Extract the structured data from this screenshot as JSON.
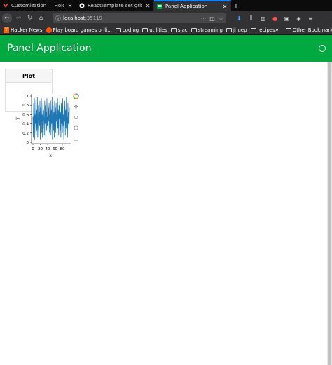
{
  "tabs": [
    {
      "label": "Customization — HoloViews",
      "icon": "holoviews-icon",
      "active": false
    },
    {
      "label": "ReactTemplate set grid item",
      "icon": "github-icon",
      "active": false
    },
    {
      "label": "Panel Application",
      "icon": "panel-icon",
      "active": true
    }
  ],
  "toolbar": {
    "url_host": "localhost",
    "url_port": ":35119",
    "overflow": "···"
  },
  "bookmarks": {
    "items": [
      {
        "label": "Hacker News",
        "icon": "hacker-news-icon"
      },
      {
        "label": "Play board games onli...",
        "icon": "boardgame-icon"
      },
      {
        "label": "coding",
        "icon": "folder-icon"
      },
      {
        "label": "utilities",
        "icon": "folder-icon"
      },
      {
        "label": "slac",
        "icon": "folder-icon"
      },
      {
        "label": "streaming",
        "icon": "folder-icon"
      },
      {
        "label": "jhuep",
        "icon": "folder-icon"
      },
      {
        "label": "recipes",
        "icon": "folder-icon"
      }
    ],
    "other": "Other Bookmarks",
    "chevron": "»"
  },
  "app": {
    "title": "Panel Application",
    "header_color": "#00aa41"
  },
  "card": {
    "title": "Plot"
  },
  "chart_data": {
    "type": "line",
    "xlabel": "x",
    "ylabel": "y",
    "xlim": [
      0,
      99
    ],
    "ylim": [
      0,
      1
    ],
    "xticks": [
      "0",
      "20",
      "40",
      "60",
      "80"
    ],
    "yticks": [
      "0",
      "0.2",
      "0.4",
      "0.6",
      "0.8",
      "1"
    ],
    "color": "#1f77b4",
    "series": [
      {
        "values": [
          0.55,
          0.1,
          0.85,
          0.3,
          0.95,
          0.05,
          0.6,
          0.4,
          0.9,
          0.15,
          0.7,
          0.25,
          0.98,
          0.1,
          0.5,
          0.8,
          0.2,
          0.65,
          0.35,
          0.9,
          0.05,
          0.75,
          0.45,
          0.95,
          0.2,
          0.6,
          0.1,
          0.85,
          0.3,
          0.7,
          0.5,
          0.15,
          0.9,
          0.4,
          0.8,
          0.05,
          0.65,
          0.25,
          0.95,
          0.35,
          0.55,
          0.1,
          0.75,
          0.45,
          0.85,
          0.2,
          0.6,
          0.3,
          0.9,
          0.15,
          0.7,
          0.4,
          0.98,
          0.05,
          0.5,
          0.8,
          0.25,
          0.65,
          0.1,
          0.9,
          0.35,
          0.75,
          0.2,
          0.85,
          0.45,
          0.6,
          0.05,
          0.95,
          0.3,
          0.7,
          0.15,
          0.8,
          0.5,
          0.9,
          0.25,
          0.65,
          0.1,
          0.85,
          0.4,
          0.75,
          0.2,
          0.95,
          0.35,
          0.6,
          0.05,
          0.8,
          0.45,
          0.9,
          0.15,
          0.7,
          0.3,
          0.98,
          0.25,
          0.55,
          0.1,
          0.85,
          0.4,
          0.65,
          0.2,
          0.75
        ]
      }
    ]
  }
}
